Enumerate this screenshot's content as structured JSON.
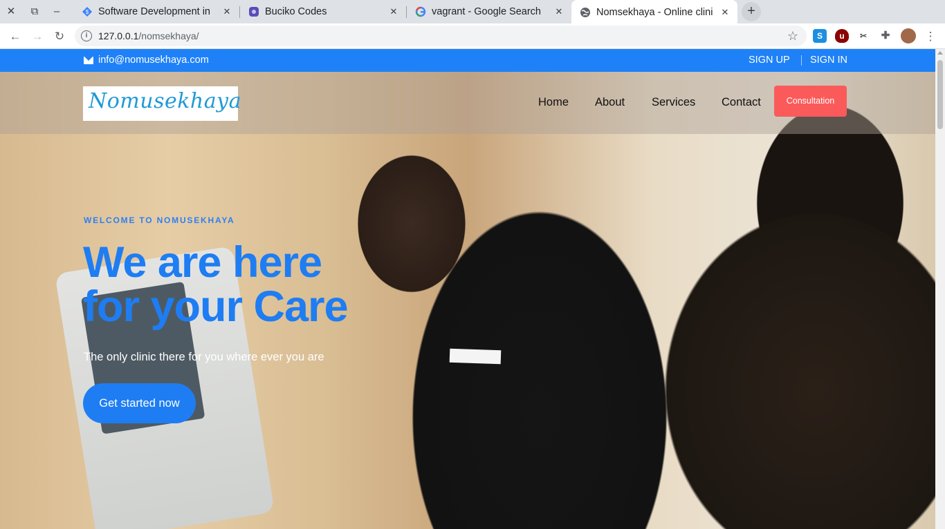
{
  "browser": {
    "tabs": [
      {
        "title": "Software Development in",
        "favicon": "diamond-icon",
        "active": false
      },
      {
        "title": "Buciko Codes",
        "favicon": "app-icon",
        "active": false
      },
      {
        "title": "vagrant - Google Search",
        "favicon": "google-icon",
        "active": false
      },
      {
        "title": "Nomsekhaya - Online clini",
        "favicon": "globe-icon",
        "active": true
      }
    ],
    "address": {
      "host": "127.0.0.1",
      "path": "/nomsekhaya/"
    }
  },
  "page": {
    "topbar": {
      "email": "info@nomusekhaya.com",
      "signup": "SIGN UP",
      "signin": "SIGN IN"
    },
    "logo_text": "Nomusekhaya",
    "nav": [
      "Home",
      "About",
      "Services",
      "Contact"
    ],
    "consultation_label": "Consultation",
    "hero": {
      "eyebrow": "WELCOME TO NOMUSEKHAYA",
      "headline_line1": "We are here",
      "headline_line2": "for your Care",
      "subline": "The only clinic there for you where ever you are",
      "cta": "Get started now"
    },
    "colors": {
      "brand_blue": "#1e81f8",
      "consultation_red": "#fb5a5a"
    }
  }
}
